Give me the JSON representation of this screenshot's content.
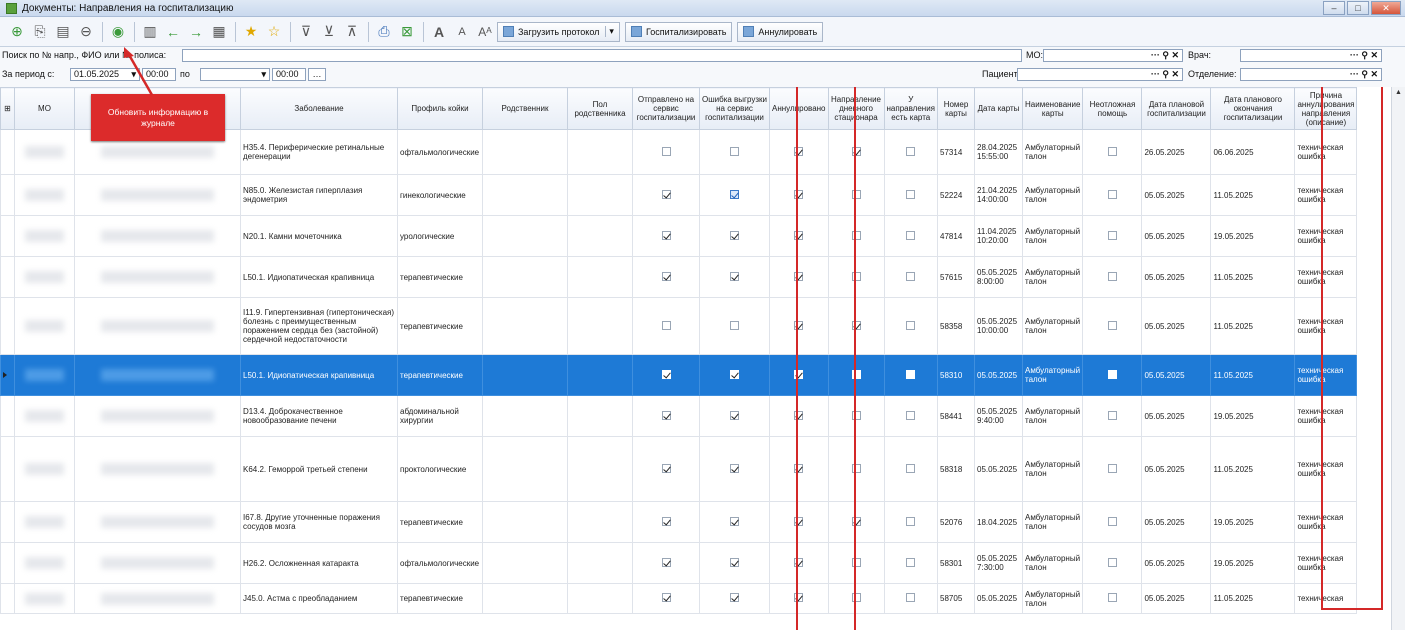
{
  "window": {
    "title": "Документы: Направления на госпитализацию"
  },
  "toolbar": {
    "load_protocol": "Загрузить протокол",
    "hospitalize": "Госпитализировать",
    "annul": "Аннулировать"
  },
  "filters": {
    "search_label": "Поиск по № напр., ФИО или № полиса:",
    "period_label": "За период с:",
    "date_from": "01.05.2025",
    "time_from": "00:00",
    "to_label": "по",
    "date_to": "",
    "time_to": "00:00",
    "mo_label": "МО:",
    "doctor_label": "Врач:",
    "patient_label": "Пациент:",
    "department_label": "Отделение:"
  },
  "tooltip": {
    "text": "Обновить информацию в журнале"
  },
  "table": {
    "columns": [
      "МО",
      "",
      "Заболевание",
      "Профиль койки",
      "Родственник",
      "Пол родственника",
      "Отправлено на сервис госпитализации",
      "Ошибка выгрузки на сервис госпитализации",
      "Аннулировано",
      "Направление дневного стационара",
      "У направления есть карта",
      "Номер карты",
      "Дата карты",
      "Наименование карты",
      "Неотложная помощь",
      "Дата плановой госпитализации",
      "Дата планового окончания госпитализации",
      "Причина аннулирования направления (описание)"
    ],
    "rows": [
      {
        "disease": "H35.4. Периферические ретинальные дегенерации",
        "profile": "офтальмологические",
        "sent": false,
        "error": false,
        "annul": true,
        "day": true,
        "hascard": false,
        "card": "57314",
        "date": "28.04.2025 15:55:00",
        "cardname": "Амбулаторный талон",
        "urgent": false,
        "plan": "26.05.2025",
        "planend": "06.06.2025",
        "reason": "техническая ошибка"
      },
      {
        "disease": "N85.0. Железистая гиперплазия эндометрия",
        "profile": "гинекологические",
        "sent": true,
        "error": true,
        "annul": true,
        "day": false,
        "hascard": false,
        "card": "52224",
        "date": "21.04.2025 14:00:00",
        "cardname": "Амбулаторный талон",
        "urgent": false,
        "plan": "05.05.2025",
        "planend": "11.05.2025",
        "reason": "техническая ошибка"
      },
      {
        "disease": "N20.1. Камни мочеточника",
        "profile": "урологические",
        "sent": true,
        "error": true,
        "annul": true,
        "day": false,
        "hascard": false,
        "card": "47814",
        "date": "11.04.2025 10:20:00",
        "cardname": "Амбулаторный талон",
        "urgent": false,
        "plan": "05.05.2025",
        "planend": "19.05.2025",
        "reason": "техническая ошибка"
      },
      {
        "disease": "L50.1. Идиопатическая крапивница",
        "profile": "терапевтические",
        "sent": true,
        "error": true,
        "annul": true,
        "day": false,
        "hascard": false,
        "card": "57615",
        "date": "05.05.2025 8:00:00",
        "cardname": "Амбулаторный талон",
        "urgent": false,
        "plan": "05.05.2025",
        "planend": "11.05.2025",
        "reason": "техническая ошибка"
      },
      {
        "disease": "I11.9. Гипертензивная (гипертоническая) болезнь с преимущественным поражением сердца без (застойной) сердечной недостаточности",
        "profile": "терапевтические",
        "sent": false,
        "error": false,
        "annul": true,
        "day": true,
        "hascard": false,
        "card": "58358",
        "date": "05.05.2025 10:00:00",
        "cardname": "Амбулаторный талон",
        "urgent": false,
        "plan": "05.05.2025",
        "planend": "11.05.2025",
        "reason": "техническая ошибка"
      },
      {
        "disease": "L50.1. Идиопатическая крапивница",
        "profile": "терапевтические",
        "sent": true,
        "error": true,
        "annul": true,
        "day": false,
        "hascard": false,
        "card": "58310",
        "date": "05.05.2025",
        "cardname": "Амбулаторный талон",
        "urgent": false,
        "plan": "05.05.2025",
        "planend": "11.05.2025",
        "reason": "техническая ошибка"
      },
      {
        "disease": "D13.4. Доброкачественное новообразование печени",
        "profile": "абдоминальной хирургии",
        "sent": true,
        "error": true,
        "annul": true,
        "day": false,
        "hascard": false,
        "card": "58441",
        "date": "05.05.2025 9:40:00",
        "cardname": "Амбулаторный талон",
        "urgent": false,
        "plan": "05.05.2025",
        "planend": "19.05.2025",
        "reason": "техническая ошибка"
      },
      {
        "disease": "K64.2. Геморрой третьей степени",
        "profile": "проктологические",
        "sent": true,
        "error": true,
        "annul": true,
        "day": false,
        "hascard": false,
        "card": "58318",
        "date": "05.05.2025",
        "cardname": "Амбулаторный талон",
        "urgent": false,
        "plan": "05.05.2025",
        "planend": "11.05.2025",
        "reason": "техническая ошибка"
      },
      {
        "disease": "I67.8. Другие уточненные поражения сосудов мозга",
        "profile": "терапевтические",
        "sent": true,
        "error": true,
        "annul": true,
        "day": true,
        "hascard": false,
        "card": "52076",
        "date": "18.04.2025",
        "cardname": "Амбулаторный талон",
        "urgent": false,
        "plan": "05.05.2025",
        "planend": "19.05.2025",
        "reason": "техническая ошибка"
      },
      {
        "disease": "H26.2. Осложненная катаракта",
        "profile": "офтальмологические",
        "sent": true,
        "error": true,
        "annul": true,
        "day": false,
        "hascard": false,
        "card": "58301",
        "date": "05.05.2025 7:30:00",
        "cardname": "Амбулаторный талон",
        "urgent": false,
        "plan": "05.05.2025",
        "planend": "19.05.2025",
        "reason": "техническая ошибка"
      },
      {
        "disease": "J45.0. Астма с преобладанием",
        "profile": "терапевтические",
        "sent": true,
        "error": true,
        "annul": true,
        "day": false,
        "hascard": false,
        "card": "58705",
        "date": "05.05.2025",
        "cardname": "Амбулаторный талон",
        "urgent": false,
        "plan": "05.05.2025",
        "planend": "11.05.2025",
        "reason": "техническая"
      }
    ]
  }
}
